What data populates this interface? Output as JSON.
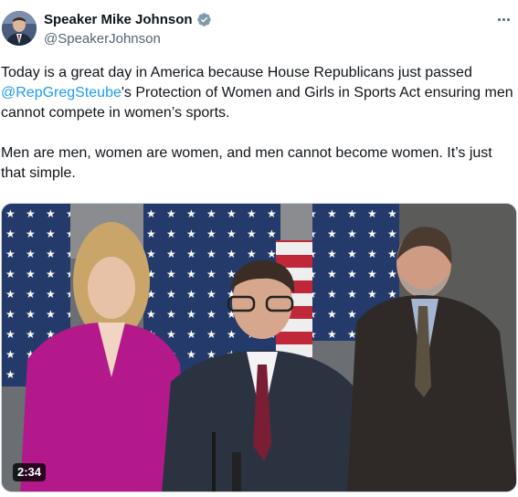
{
  "author": {
    "name": "Speaker Mike Johnson",
    "handle": "@SpeakerJohnson",
    "verified_icon": "verified-badge-icon",
    "verified_color": "#829aab",
    "avatar_icon": "profile-photo"
  },
  "tweet": {
    "p1_before": "Today is a great day in America because House Republicans just passed ",
    "mention": "@RepGregSteube",
    "p1_after": "'s Protection of Women and Girls in Sports Act ensuring men cannot compete in women’s sports.",
    "p2": "Men are men, women are women, and men cannot become women. It’s just that simple."
  },
  "media": {
    "type": "video",
    "duration": "2:34"
  },
  "menu": {
    "icon": "more-options-icon"
  },
  "colors": {
    "link": "#1d9bf0",
    "secondary_text": "#536471",
    "primary_text": "#0f1419"
  }
}
